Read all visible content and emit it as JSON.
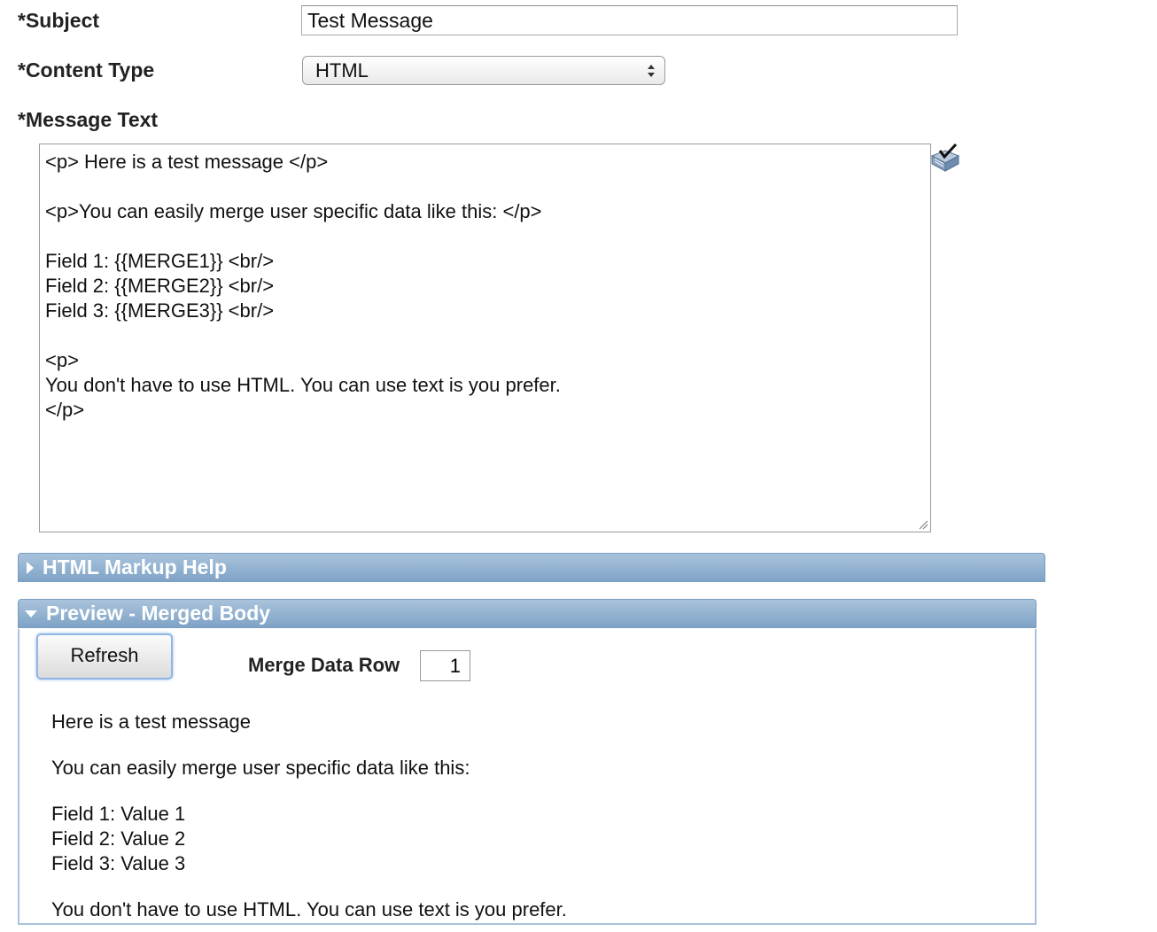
{
  "subject": {
    "label": "*Subject",
    "value": "Test Message"
  },
  "content_type": {
    "label": "*Content Type",
    "selected": "HTML"
  },
  "message_text": {
    "label": "*Message Text",
    "lines": [
      "<p> Here is a test message </p>",
      "",
      "<p>You can easily merge user specific data like this: </p>",
      "",
      "Field 1: {{MERGE1}} <br/>",
      "Field 2: {{MERGE2}} <br/>",
      "Field 3: {{MERGE3}} <br/>",
      "",
      "<p>",
      "You don't have to use HTML. You can use text is you prefer.",
      "</p>"
    ]
  },
  "html_markup_help": {
    "title": "HTML Markup Help"
  },
  "preview": {
    "title": "Preview - Merged Body",
    "refresh_label": "Refresh",
    "merge_row_label": "Merge Data Row",
    "merge_row_value": "1",
    "body": {
      "p1": "Here is a test message",
      "p2": "You can easily merge user specific data like this:",
      "fields": [
        "Field 1: Value 1",
        "Field 2: Value 2",
        "Field 3: Value 3"
      ],
      "p3": "You don't have to use HTML. You can use text is you prefer."
    }
  },
  "colors": {
    "header_bar": "#8fb0d1",
    "focus_ring": "#8fb6e6"
  }
}
